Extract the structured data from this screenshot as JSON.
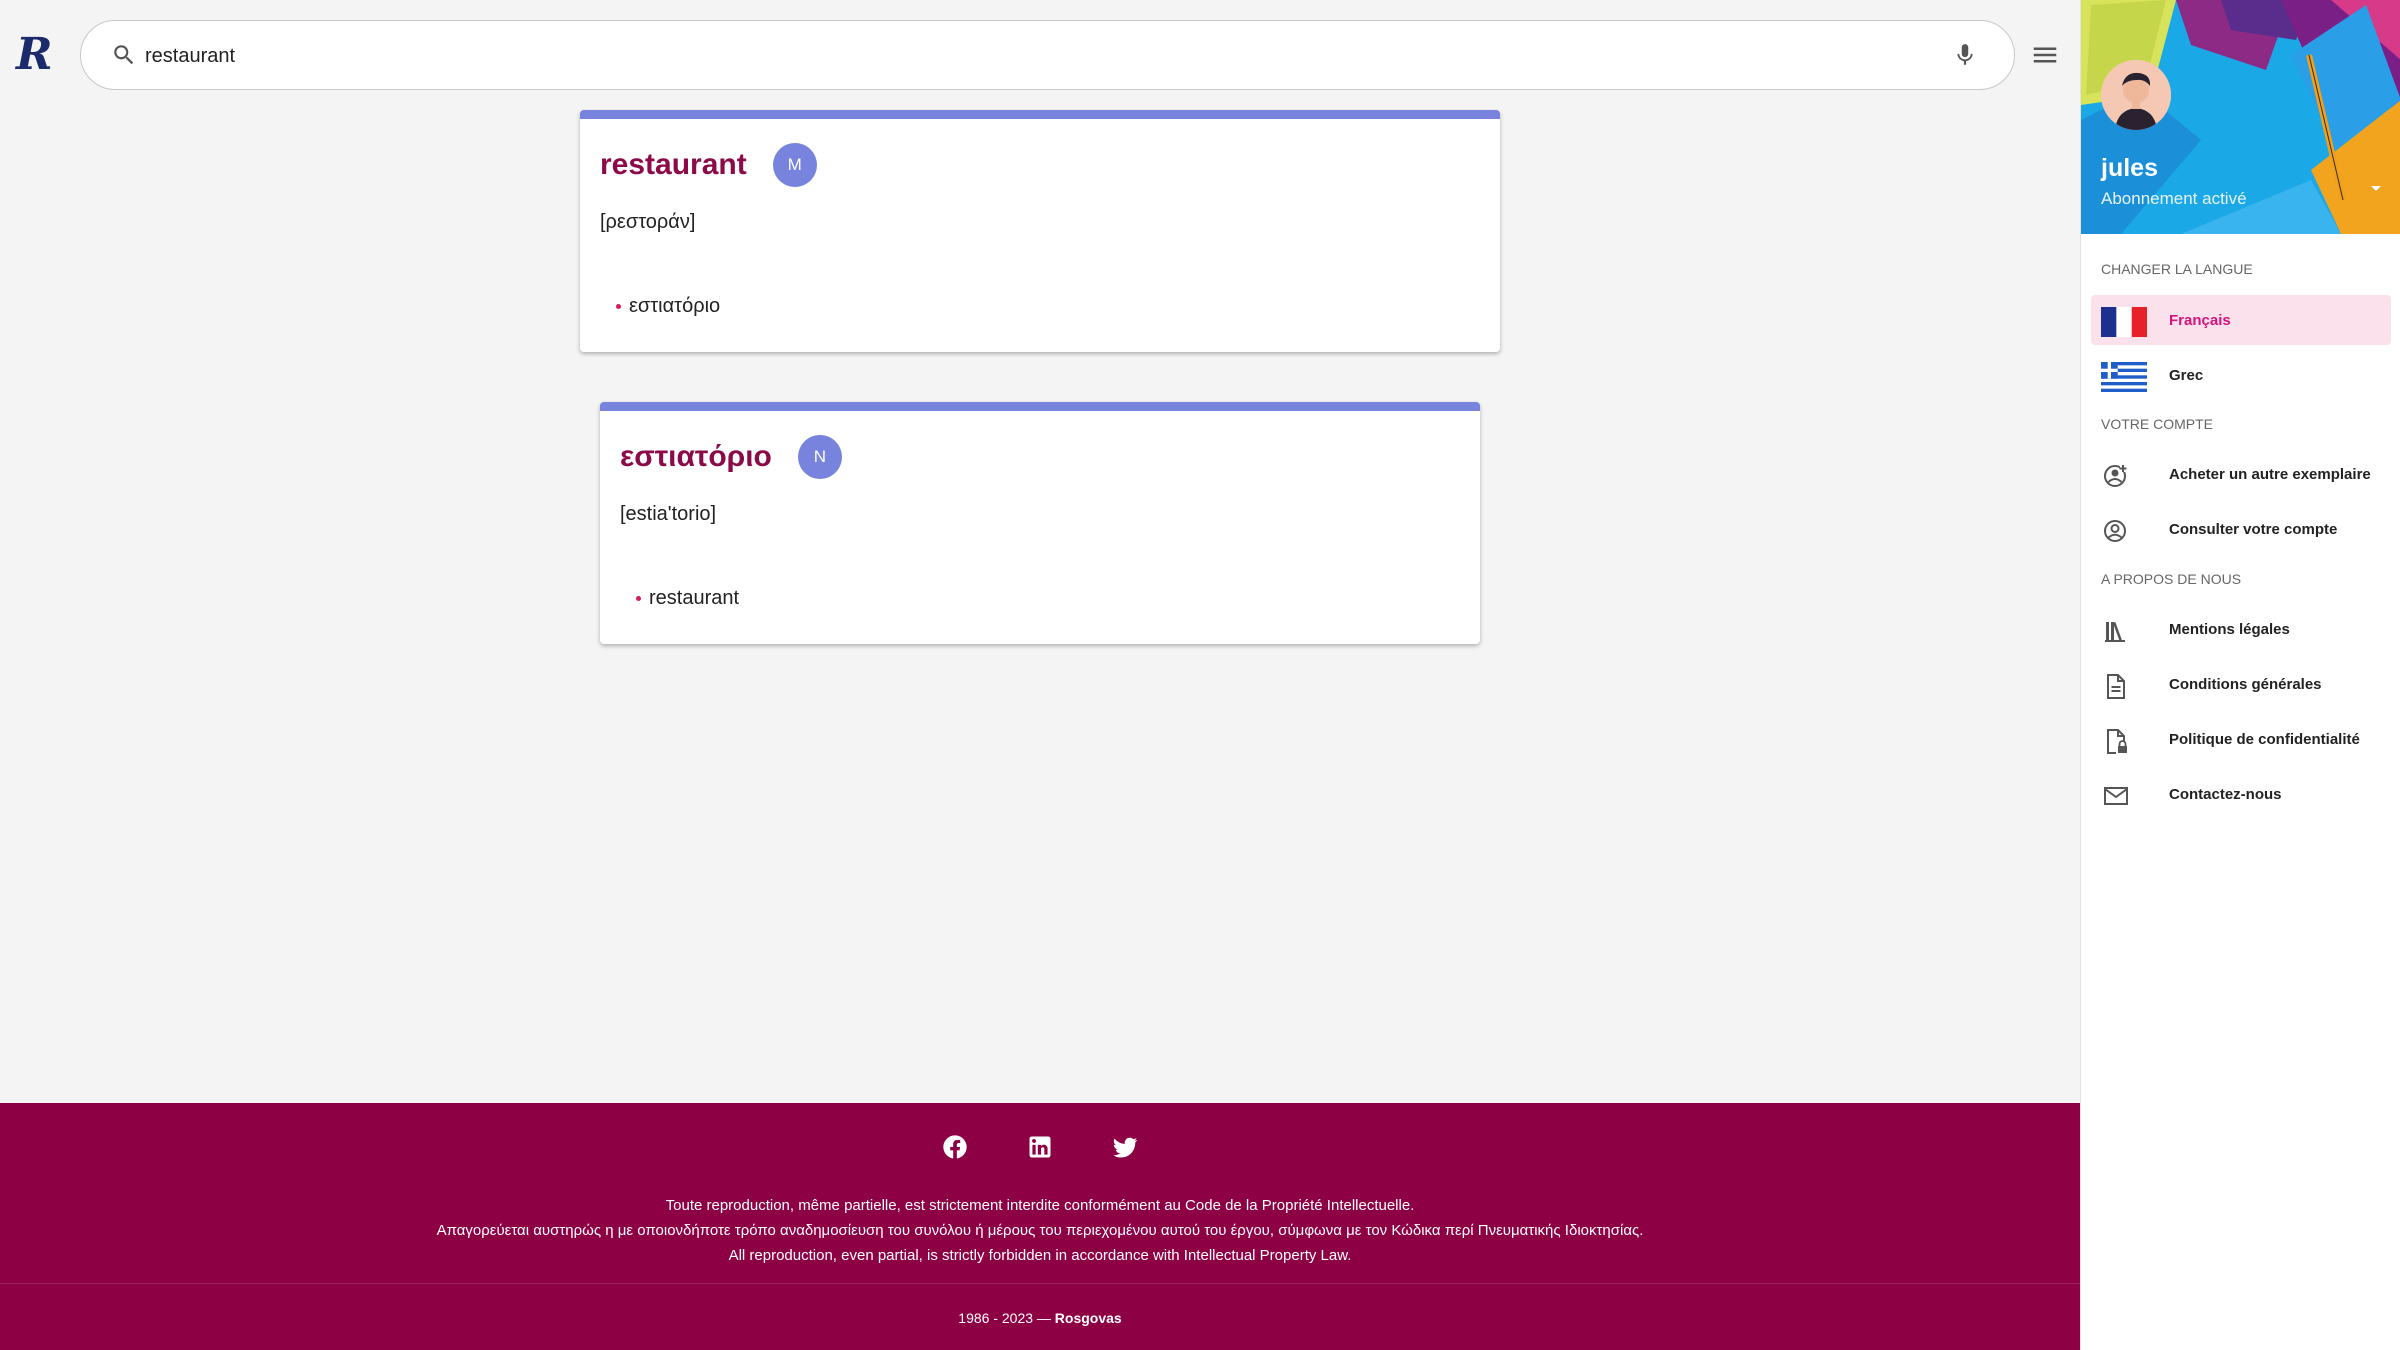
{
  "search": {
    "query": "restaurant",
    "placeholder": ""
  },
  "results": [
    {
      "word": "restaurant",
      "gender": "M",
      "pronunciation": "[ρεστοράν]",
      "translations": [
        "εστιατόριο"
      ]
    },
    {
      "word": "εστιατόριο",
      "gender": "N",
      "pronunciation": "[estia'torio]",
      "translations": [
        "restaurant"
      ]
    }
  ],
  "footer": {
    "notice_fr": "Toute reproduction, même partielle, est strictement interdite conformément au Code de la Propriété Intellectuelle.",
    "notice_el": "Απαγορεύεται αυστηρώς η με οποιονδήποτε τρόπο αναδημοσίευση του συνόλου ή μέρους του περιεχομένου αυτού του έργου, σύμφωνα με τον Κώδικα περί Πνευματικής Ιδιοκτησίας.",
    "notice_en": "All reproduction, even partial, is strictly forbidden in accordance with Intellectual Property Law.",
    "years": "1986 - 2023 —",
    "brand": "Rosgovas",
    "socials": [
      "facebook-icon",
      "linkedin-icon",
      "twitter-icon"
    ]
  },
  "drawer": {
    "user": {
      "name": "jules",
      "status": "Abonnement activé"
    },
    "language_section": "CHANGER LA LANGUE",
    "languages": [
      {
        "label": "Français",
        "icon": "french-flag-icon",
        "active": true
      },
      {
        "label": "Grec",
        "icon": "greek-flag-icon",
        "active": false
      }
    ],
    "account_section": "VOTRE COMPTE",
    "account_items": [
      {
        "label": "Acheter un autre exemplaire",
        "icon": "account-add-icon"
      },
      {
        "label": "Consulter votre compte",
        "icon": "account-circle-icon"
      }
    ],
    "about_section": "A PROPOS DE NOUS",
    "about_items": [
      {
        "label": "Mentions légales",
        "icon": "library-icon"
      },
      {
        "label": "Conditions générales",
        "icon": "document-icon"
      },
      {
        "label": "Politique de confidentialité",
        "icon": "document-lock-icon"
      },
      {
        "label": "Contactez-nous",
        "icon": "mail-icon"
      }
    ]
  },
  "colors": {
    "accent": "#7783dd",
    "word": "#8b0a47",
    "footer": "#8e0044",
    "active": "#d4147a"
  }
}
